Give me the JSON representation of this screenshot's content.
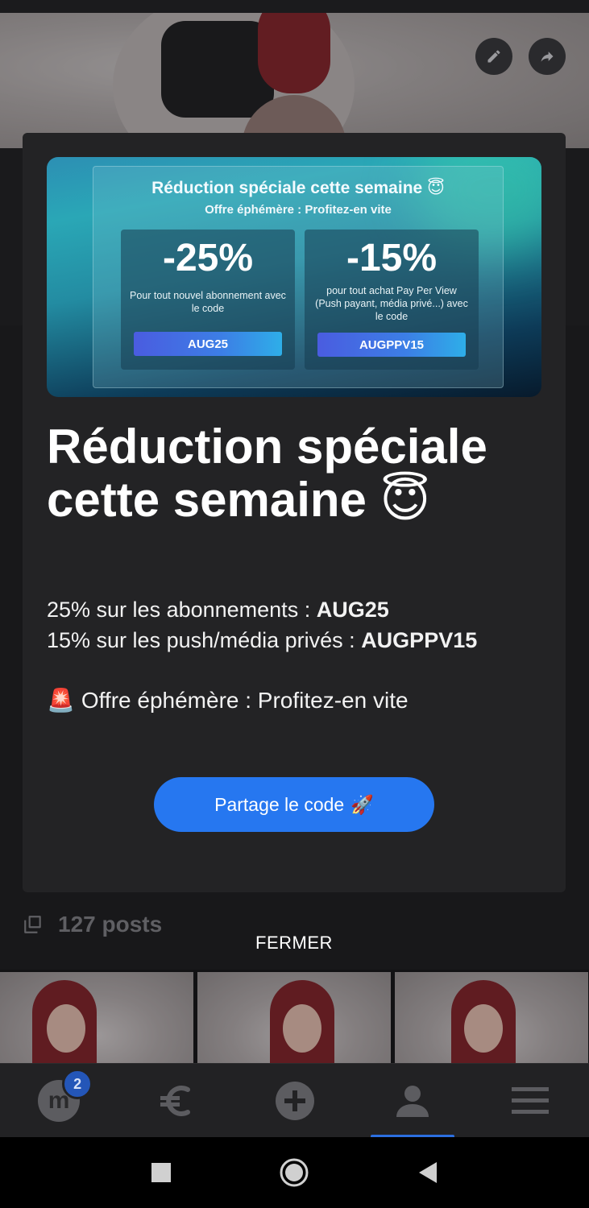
{
  "banner": {
    "title": "Réduction spéciale cette semaine 😇",
    "subtitle": "Offre éphémère : Profitez-en vite",
    "coupons": [
      {
        "percent": "-25%",
        "description": "Pour tout nouvel abonnement avec le code",
        "code": "AUG25"
      },
      {
        "percent": "-15%",
        "description": "pour tout achat Pay Per View (Push payant, média privé...) avec le code",
        "code": "AUGPPV15"
      }
    ]
  },
  "modal": {
    "title": "Réduction spéciale cette semaine 😇",
    "line1_text": "25% sur les abonnements : ",
    "line1_code": "AUG25",
    "line2_text": "15% sur les push/média privés : ",
    "line2_code": "AUGPPV15",
    "alert_icon": "🚨",
    "alert_text": "Offre éphémère : Profitez-en vite",
    "share_label": "Partage le code",
    "share_icon": "🚀",
    "close_label": "FERMER"
  },
  "profile": {
    "posts_count": "127 posts"
  },
  "bottom_nav": {
    "logo_letter": "m",
    "notification_count": "2",
    "items": [
      "home",
      "earnings",
      "create",
      "profile",
      "menu"
    ],
    "active": "profile"
  },
  "colors": {
    "accent": "#2677f0",
    "modal_bg": "#232325",
    "nav_active": "#2c6fe0"
  }
}
